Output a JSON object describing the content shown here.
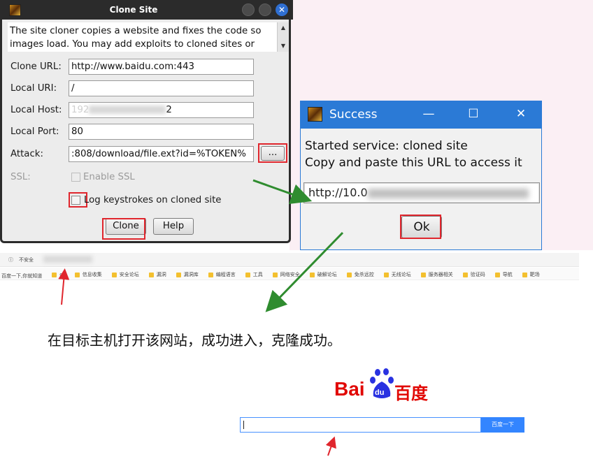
{
  "clone_dialog": {
    "title": "Clone Site",
    "description": "The site cloner copies a website and fixes the code so\nimages load. You may add exploits to cloned sites or",
    "fields": {
      "clone_url_label": "Clone URL:",
      "clone_url_value": "http://www.baidu.com:443",
      "local_uri_label": "Local URI:",
      "local_uri_value": "/",
      "local_host_label": "Local Host:",
      "local_host_value_visible_start": "192",
      "local_host_value_visible_end": "2",
      "local_port_label": "Local Port:",
      "local_port_value": "80",
      "attack_label": "Attack:",
      "attack_value": ":808/download/file.ext?id=%TOKEN%",
      "attack_browse": "...",
      "ssl_label": "SSL:",
      "enable_ssl_label": "Enable SSL",
      "log_keystrokes_label": "Log keystrokes on cloned site"
    },
    "buttons": {
      "clone": "Clone",
      "help": "Help"
    },
    "window_controls": {
      "close_glyph": "✕"
    }
  },
  "success_dialog": {
    "title": "Success",
    "line1": "Started service: cloned site",
    "line2": "Copy and paste this URL to access it",
    "url_value_visible": "http://10.0",
    "ok_label": "Ok",
    "minimize": "—",
    "maximize": "☐",
    "close": "✕"
  },
  "browser": {
    "security_label": "不安全",
    "bookmarks": [
      "百度一下,你就知道",
      "cs",
      "信息收集",
      "安全论坛",
      "漏洞",
      "漏洞库",
      "编程语言",
      "工具",
      "网络安全",
      "破解论坛",
      "免杀远控",
      "无线论坛",
      "服务器相关",
      "验证码",
      "导航",
      "靶场"
    ]
  },
  "caption": "在目标主机打开该网站，成功进入，克隆成功。",
  "baidu": {
    "logo_text_left": "Bai",
    "logo_text_du": "du",
    "logo_text_right": "百度",
    "search_button": "百度一下"
  },
  "colors": {
    "annotation_red": "#e0262d",
    "arrow_green": "#2f8c2f",
    "success_title_bar": "#2b7ad6",
    "clone_title_bar": "#2b2b2b",
    "baidu_red": "#e10602",
    "baidu_blue": "#2932e1",
    "baidu_button": "#3385ff"
  }
}
